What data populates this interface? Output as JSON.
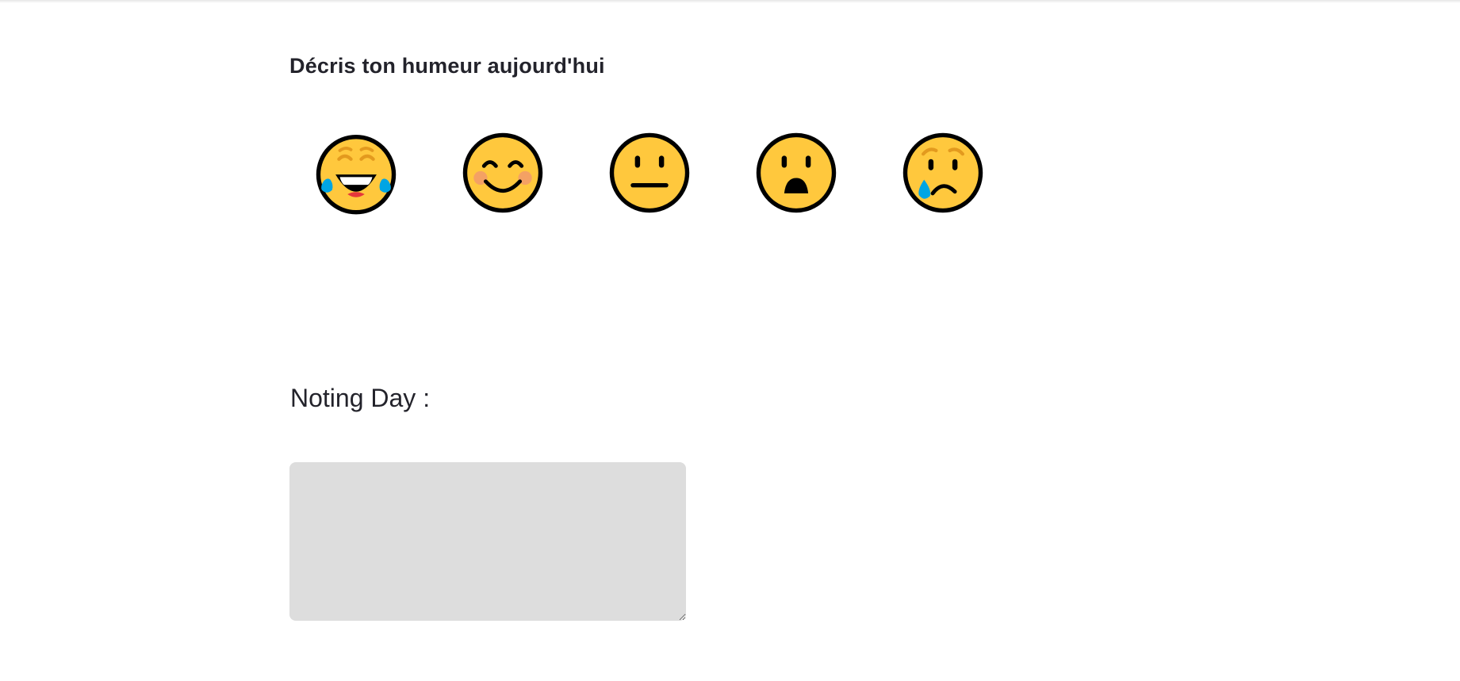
{
  "mood": {
    "title": "Décris ton humeur aujourd'hui",
    "options": [
      {
        "icon": "face-with-tears-of-joy-icon"
      },
      {
        "icon": "smiling-face-icon"
      },
      {
        "icon": "neutral-face-icon"
      },
      {
        "icon": "frowning-face-open-mouth-icon"
      },
      {
        "icon": "crying-face-icon"
      }
    ]
  },
  "noting": {
    "label": "Noting Day :",
    "textarea_value": "",
    "textarea_placeholder": ""
  },
  "colors": {
    "emoji_fill": "#FFC83D",
    "emoji_outline": "#000000",
    "tear": "#00A5E3",
    "textarea_bg": "#DDDDDD",
    "text": "#23232B"
  }
}
